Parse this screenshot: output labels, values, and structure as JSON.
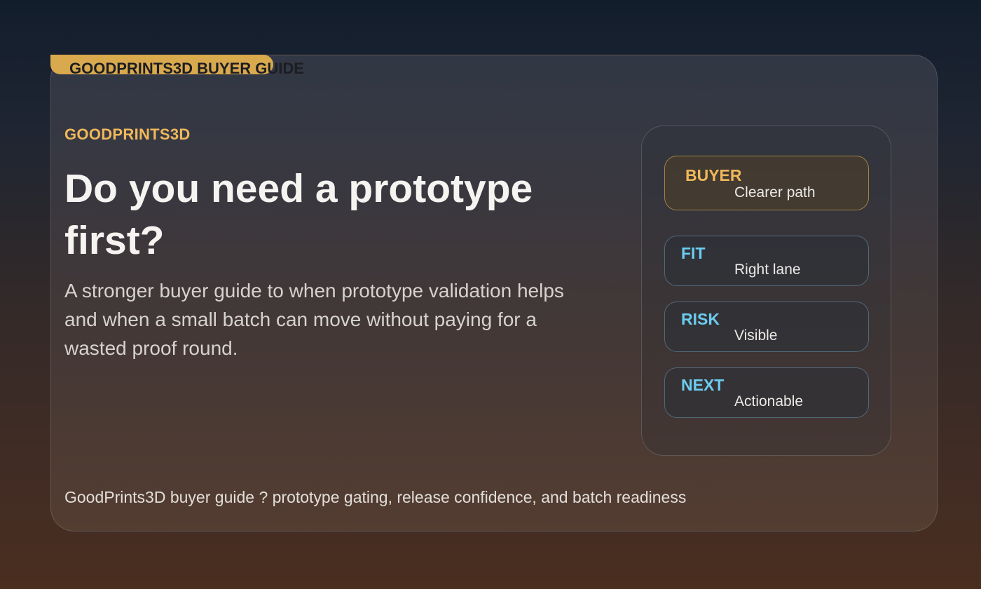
{
  "badge": {
    "label": "GOODPRINTS3D BUYER GUIDE"
  },
  "hero": {
    "eyebrow": "GOODPRINTS3D",
    "headline": "Do you need a prototype first?",
    "subtitle": "A stronger buyer guide to when prototype validation helps and when a small batch can move without paying for a wasted proof round."
  },
  "tiles": [
    {
      "title": "BUYER",
      "value": "Clearer path"
    },
    {
      "title": "FIT",
      "value": "Right lane"
    },
    {
      "title": "RISK",
      "value": "Visible"
    },
    {
      "title": "NEXT",
      "value": "Actionable"
    }
  ],
  "footer": {
    "text": "GoodPrints3D buyer guide ? prototype gating, release confidence, and batch readiness"
  },
  "colors": {
    "accent_gold": "#d9a94e",
    "accent_blue": "#6ccbf0",
    "headline": "#f6f4f1"
  }
}
